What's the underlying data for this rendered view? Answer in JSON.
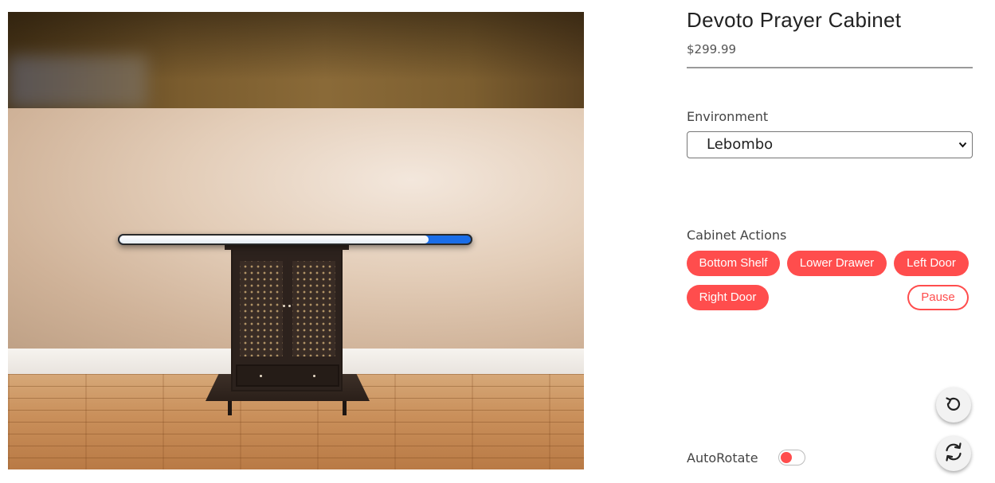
{
  "product": {
    "title": "Devoto Prayer Cabinet",
    "price": "$299.99"
  },
  "environment": {
    "label": "Environment",
    "selected": "Lebombo",
    "options": [
      "Lebombo"
    ]
  },
  "actions": {
    "label": "Cabinet Actions",
    "buttons": [
      "Bottom Shelf",
      "Lower Drawer",
      "Left Door",
      "Right Door"
    ],
    "pause": "Pause"
  },
  "viewer": {
    "loading_progress": 0.88
  },
  "controls": {
    "reset_icon": "undo-icon",
    "rotate_icon": "refresh-icon"
  },
  "autorotate": {
    "label": "AutoRotate",
    "enabled": false
  },
  "colors": {
    "accent": "#ff4d4d",
    "progress": "#1a6de8"
  }
}
